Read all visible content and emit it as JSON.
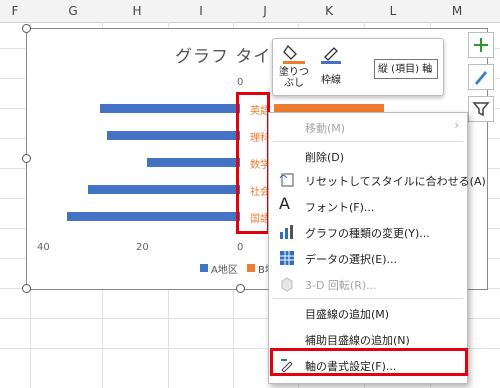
{
  "columns": [
    "F",
    "G",
    "H",
    "I",
    "J",
    "K",
    "L",
    "M"
  ],
  "chart": {
    "title": "グラフ タイ",
    "x_ticks": [
      "40",
      "20",
      "0",
      "0"
    ],
    "categories": [
      "英語",
      "理科",
      "数学",
      "社会",
      "国語"
    ],
    "legend": {
      "series_a": "A地区",
      "series_b": "B地"
    }
  },
  "chart_data": {
    "type": "bar",
    "title": "グラフ タイ",
    "categories": [
      "英語",
      "理科",
      "数学",
      "社会",
      "国語"
    ],
    "series": [
      {
        "name": "A地区",
        "values": [
          28,
          27,
          19,
          30,
          35
        ]
      },
      {
        "name": "B地",
        "values": [
          22,
          0,
          0,
          0,
          0
        ]
      }
    ],
    "xlim": [
      40,
      0
    ]
  },
  "toolbar": {
    "fill_label": "塗りつぶし",
    "outline_label": "枠線",
    "element_selected": "縦 (項目) 軸"
  },
  "context_menu": {
    "items": [
      {
        "label": "移動(M)",
        "icon": "none",
        "disabled": true,
        "arrow": "›"
      },
      {
        "label": "削除(D)",
        "icon": "none",
        "disabled": false
      },
      {
        "label": "リセットしてスタイルに合わせる(A)",
        "icon": "reset-style-icon",
        "disabled": false
      },
      {
        "label": "フォント(F)...",
        "icon": "font-icon",
        "disabled": false
      },
      {
        "label": "グラフの種類の変更(Y)...",
        "icon": "chart-type-icon",
        "disabled": false
      },
      {
        "label": "データの選択(E)...",
        "icon": "select-data-icon",
        "disabled": false
      },
      {
        "label": "3-D 回転(R)...",
        "icon": "3d-rotation-icon",
        "disabled": true
      },
      {
        "label": "目盛線の追加(M)",
        "icon": "none",
        "disabled": false
      },
      {
        "label": "補助目盛線の追加(N)",
        "icon": "none",
        "disabled": false
      },
      {
        "label": "軸の書式設定(F)...",
        "icon": "format-axis-icon",
        "disabled": false
      }
    ]
  },
  "colors": {
    "series_a": "#4472c4",
    "series_b": "#ed7d31",
    "highlight": "#e3000f"
  }
}
